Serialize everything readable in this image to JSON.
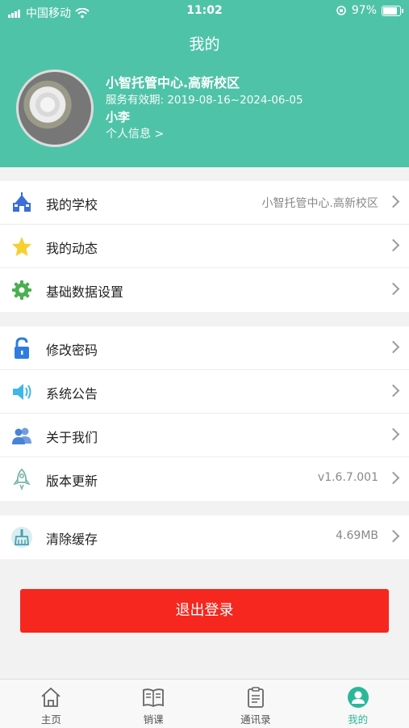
{
  "status_bar": {
    "carrier": "中国移动",
    "time": "11:02",
    "battery": "97%",
    "battery_level": 0.97
  },
  "header": {
    "title": "我的",
    "school": "小智托管中心.高新校区",
    "validity": "服务有效期: 2019-08-16~2024-06-05",
    "user": "小李",
    "profile_link": "个人信息 >"
  },
  "groups": [
    [
      {
        "label": "我的学校",
        "value": "小智托管中心.高新校区",
        "icon": "school-icon"
      },
      {
        "label": "我的动态",
        "value": "",
        "icon": "star-icon"
      },
      {
        "label": "基础数据设置",
        "value": "",
        "icon": "gear-icon"
      }
    ],
    [
      {
        "label": "修改密码",
        "value": "",
        "icon": "lock-icon"
      },
      {
        "label": "系统公告",
        "value": "",
        "icon": "speaker-icon"
      },
      {
        "label": "关于我们",
        "value": "",
        "icon": "users-icon"
      },
      {
        "label": "版本更新",
        "value": "v1.6.7.001",
        "icon": "rocket-icon"
      }
    ],
    [
      {
        "label": "清除缓存",
        "value": "4.69MB",
        "icon": "broom-icon"
      }
    ]
  ],
  "logout_label": "退出登录",
  "tabs": [
    {
      "label": "主页",
      "icon": "home-icon",
      "active": false
    },
    {
      "label": "销课",
      "icon": "book-icon",
      "active": false
    },
    {
      "label": "通讯录",
      "icon": "clipboard-icon",
      "active": false
    },
    {
      "label": "我的",
      "icon": "profile-icon",
      "active": true
    }
  ],
  "colors": {
    "header": "#4fc3a8",
    "logout": "#f5271f",
    "active_tab": "#2bb89a"
  }
}
